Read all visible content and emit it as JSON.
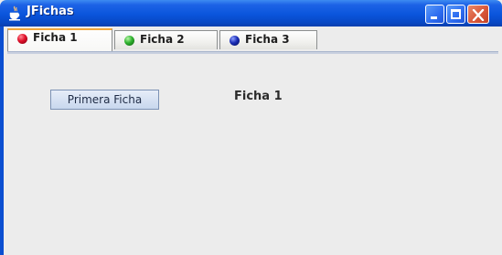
{
  "window": {
    "title": "JFichas",
    "icon": "java-cup-icon"
  },
  "titlebar_buttons": [
    {
      "name": "minimize",
      "icon": "minimize-icon"
    },
    {
      "name": "maximize",
      "icon": "maximize-icon"
    },
    {
      "name": "close",
      "icon": "close-icon"
    }
  ],
  "tabs": [
    {
      "label": "Ficha 1",
      "icon": "red-ball-icon",
      "color": "#d01028",
      "selected": true
    },
    {
      "label": "Ficha 2",
      "icon": "green-ball-icon",
      "color": "#25a325",
      "selected": false
    },
    {
      "label": "Ficha 3",
      "icon": "blue-ball-icon",
      "color": "#1a2db5",
      "selected": false
    }
  ],
  "panel": {
    "button_label": "Primera Ficha",
    "label_text": "Ficha 1"
  }
}
